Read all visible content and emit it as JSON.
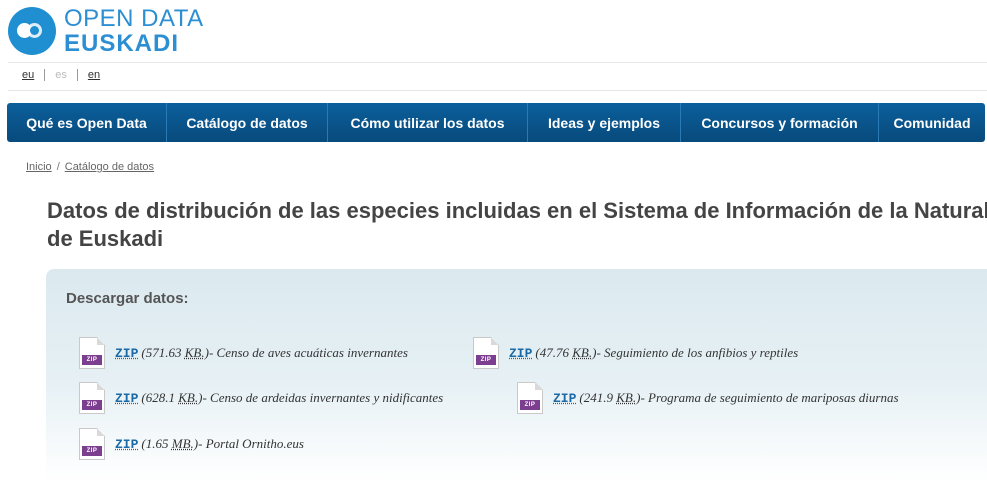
{
  "brand": {
    "line1": "OPEN DATA",
    "line2": "EUSKADI",
    "color": "#2d8fd3"
  },
  "languages": [
    {
      "code": "eu",
      "active": false
    },
    {
      "code": "es",
      "active": true
    },
    {
      "code": "en",
      "active": false
    }
  ],
  "nav": [
    "Qué es Open Data",
    "Catálogo de datos",
    "Cómo utilizar los datos",
    "Ideas y ejemplos",
    "Concursos y formación",
    "Comunidad"
  ],
  "breadcrumb": {
    "home": "Inicio",
    "separator": "/",
    "current": "Catálogo de datos"
  },
  "page": {
    "title_line1": "Datos de distribución de las especies incluidas en el Sistema de Información de la Naturaleza",
    "title_line2": "de Euskadi"
  },
  "download": {
    "heading": "Descargar datos:",
    "icon_tag": "ZIP",
    "files": [
      {
        "format": "ZIP",
        "size_open": "(571.63 ",
        "size_unit": "KB.",
        "size_close": ")",
        "desc": " - Censo de aves acuáticas invernantes"
      },
      {
        "format": "ZIP",
        "size_open": "(47.76 ",
        "size_unit": "KB.",
        "size_close": ")",
        "desc": " - Seguimiento de los anfibios y reptiles"
      },
      {
        "format": "ZIP",
        "size_open": "(628.1 ",
        "size_unit": "KB.",
        "size_close": ")",
        "desc": " - Censo de ardeidas invernantes y nidificantes"
      },
      {
        "format": "ZIP",
        "size_open": "(241.9 ",
        "size_unit": "KB.",
        "size_close": ")",
        "desc": " - Programa de seguimiento de mariposas diurnas"
      },
      {
        "format": "ZIP",
        "size_open": "(1.65 ",
        "size_unit": "MB.",
        "size_close": ")",
        "desc": " - Portal Ornitho.eus"
      }
    ]
  }
}
